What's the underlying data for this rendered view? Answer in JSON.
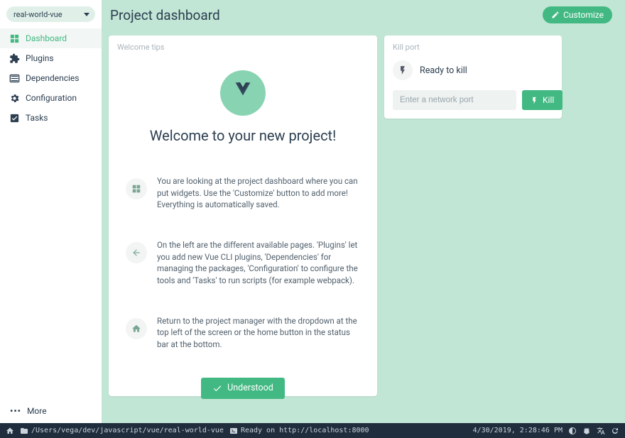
{
  "projectSelect": {
    "name": "real-world-vue"
  },
  "sidebar": {
    "items": [
      {
        "label": "Dashboard",
        "active": true
      },
      {
        "label": "Plugins"
      },
      {
        "label": "Dependencies"
      },
      {
        "label": "Configuration"
      },
      {
        "label": "Tasks"
      }
    ],
    "more": "More"
  },
  "header": {
    "title": "Project dashboard",
    "customize": "Customize"
  },
  "welcome": {
    "cardTitle": "Welcome tips",
    "heading": "Welcome to your new project!",
    "tips": [
      "You are looking at the project dashboard where you can put widgets. Use the 'Customize' button to add more! Everything is automatically saved.",
      "On the left are the different available pages. 'Plugins' let you add new Vue CLI plugins, 'Dependencies' for managing the packages, 'Configuration' to configure the tools and 'Tasks' to run scripts (for example webpack).",
      "Return to the project manager with the dropdown at the top left of the screen or the home button in the status bar at the bottom."
    ],
    "understood": "Understood"
  },
  "killPort": {
    "cardTitle": "Kill port",
    "status": "Ready to kill",
    "placeholder": "Enter a network port",
    "button": "Kill"
  },
  "statusbar": {
    "path": "/Users/vega/dev/javascript/vue/real-world-vue",
    "log": "Ready on http://localhost:8000",
    "datetime": "4/30/2019, 2:28:46 PM"
  }
}
